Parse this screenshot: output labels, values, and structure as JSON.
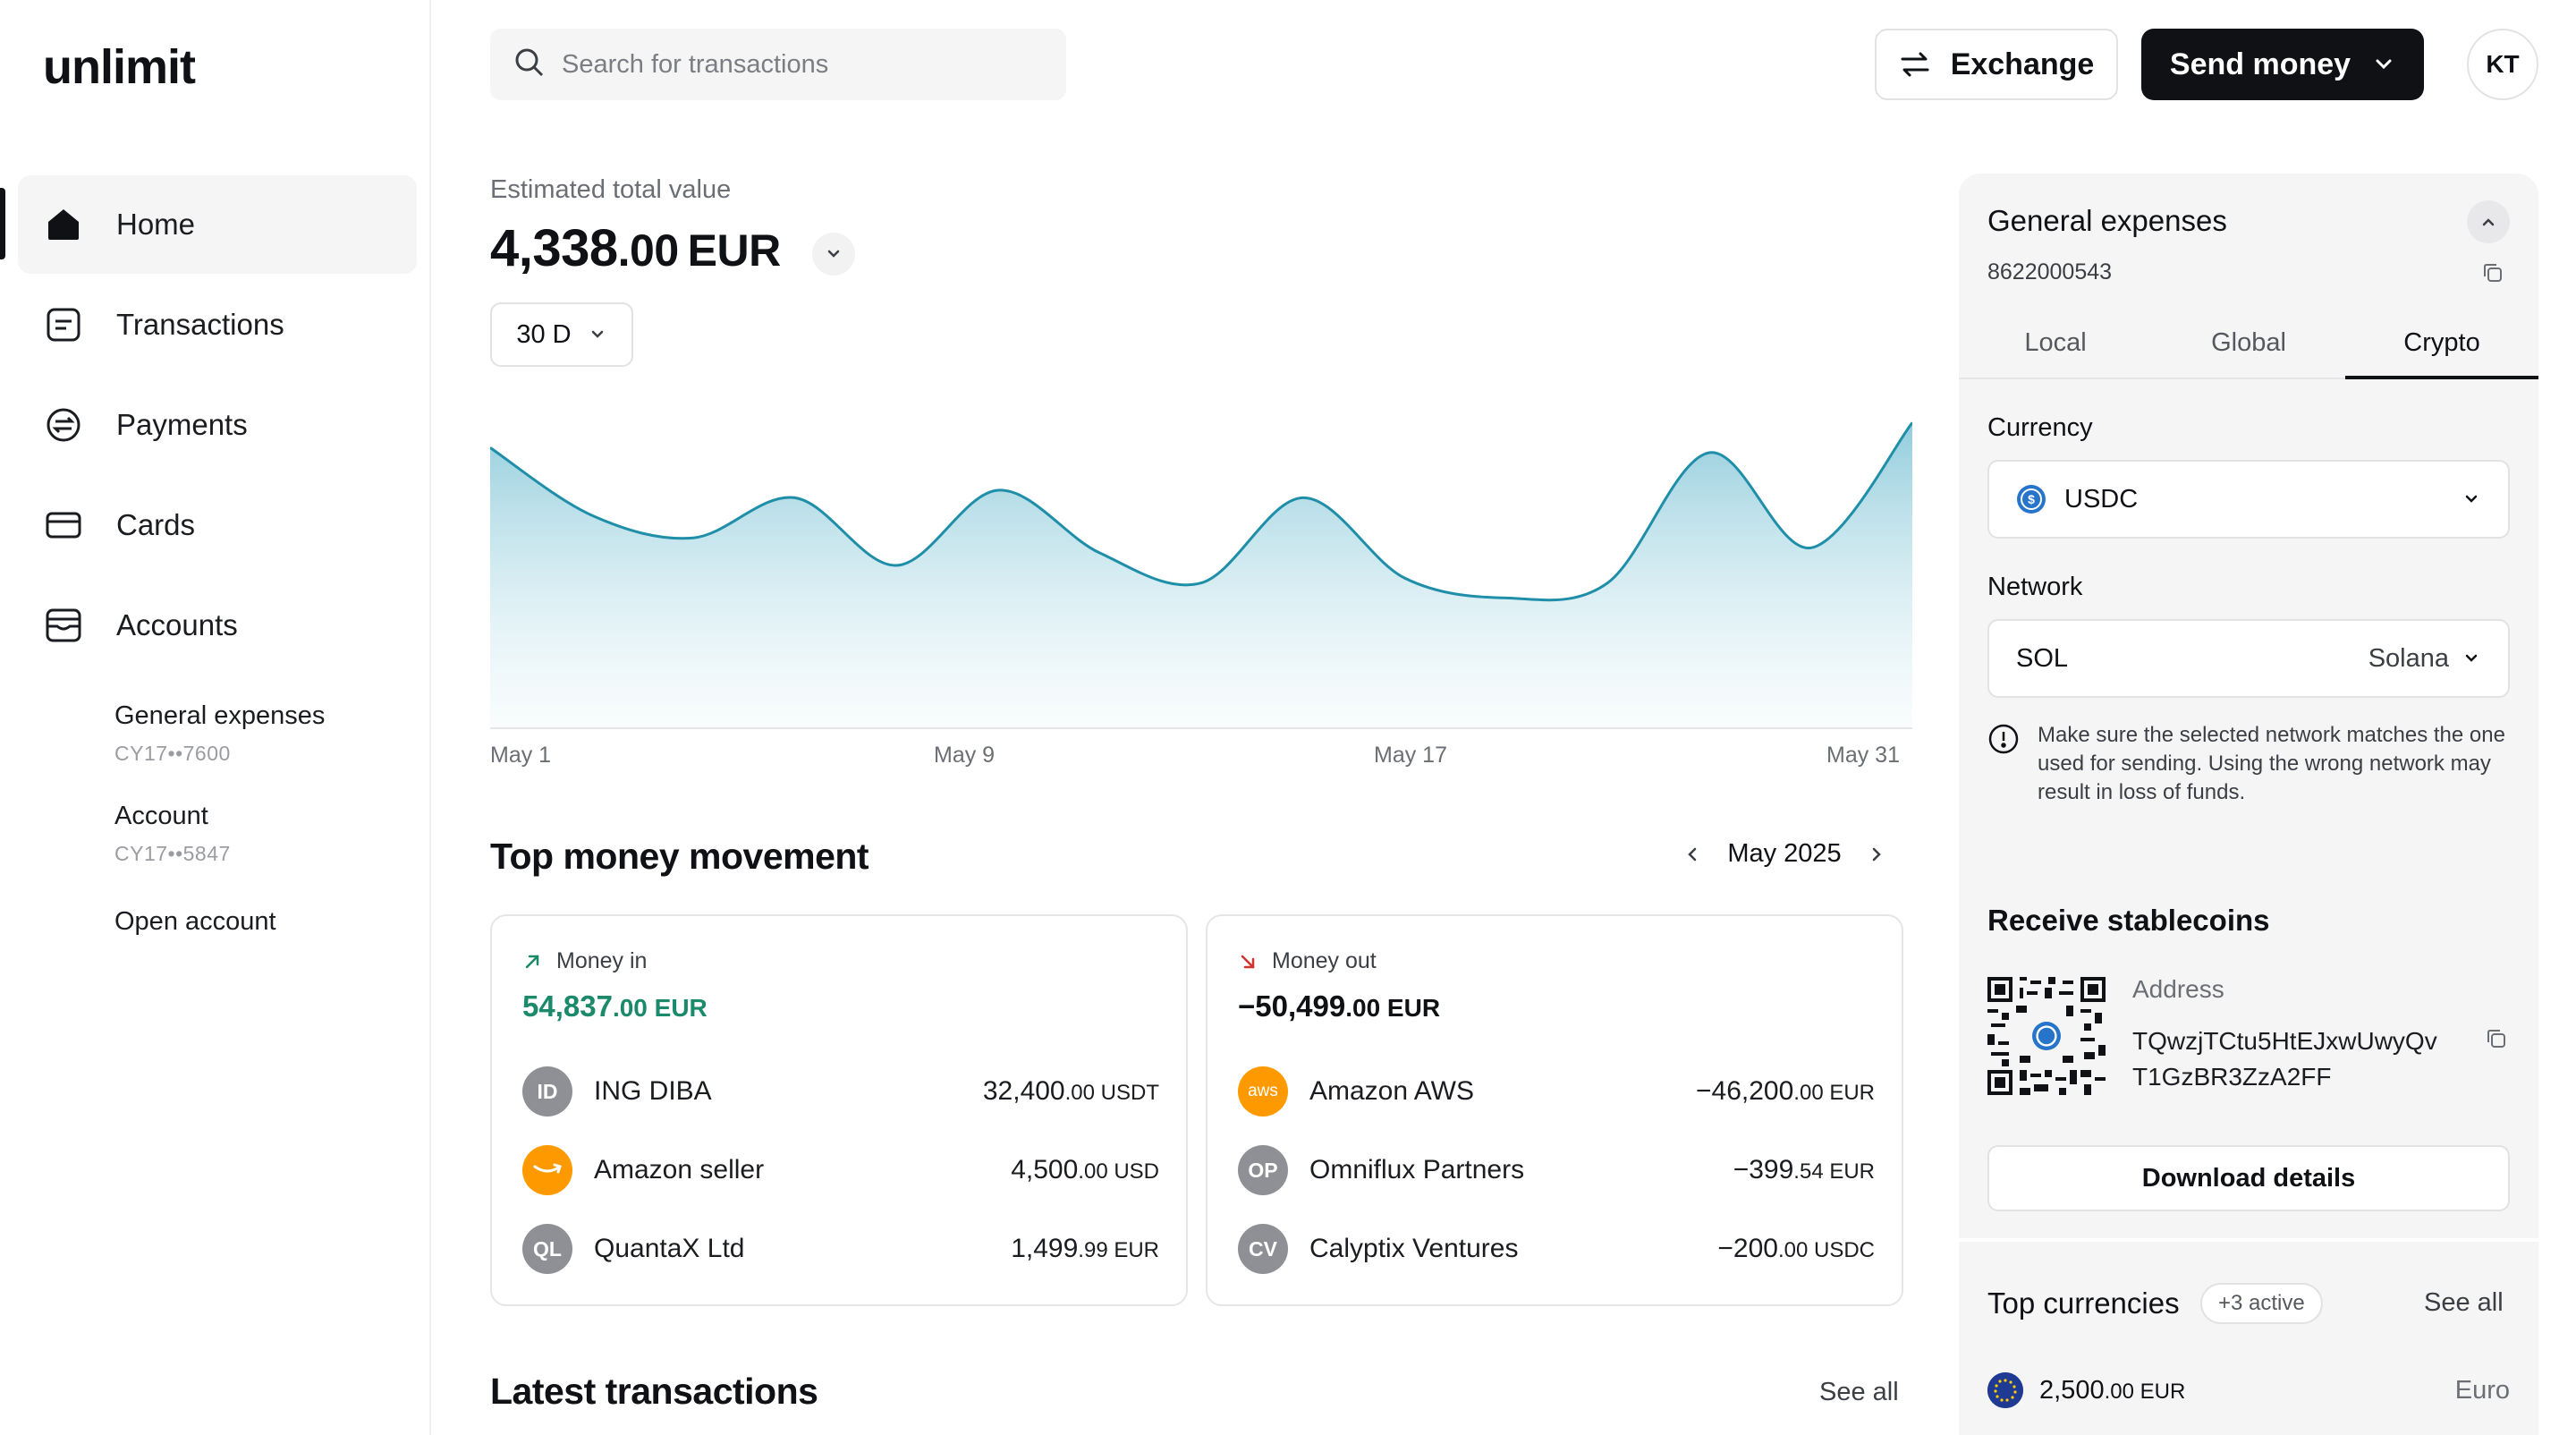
{
  "app": {
    "logo": "unlimit"
  },
  "sidebar": {
    "items": [
      {
        "label": "Home",
        "icon": "home-icon"
      },
      {
        "label": "Transactions",
        "icon": "list-icon"
      },
      {
        "label": "Payments",
        "icon": "transfer-icon"
      },
      {
        "label": "Cards",
        "icon": "card-icon"
      },
      {
        "label": "Accounts",
        "icon": "accounts-icon"
      }
    ],
    "accounts": [
      {
        "name": "General expenses",
        "number": "CY17••7600"
      },
      {
        "name": "Account",
        "number": "CY17••5847"
      }
    ],
    "open_account": "Open account"
  },
  "header": {
    "search_placeholder": "Search for transactions",
    "exchange_label": "Exchange",
    "send_label": "Send money",
    "avatar_initials": "KT"
  },
  "summary": {
    "label": "Estimated total value",
    "amount_int": "4,338",
    "amount_dec": ".00",
    "currency": "EUR",
    "period": "30 D"
  },
  "chart_data": {
    "type": "area",
    "x_ticks": [
      "May 1",
      "May 9",
      "May 17",
      "May 31"
    ],
    "values": [
      0.82,
      0.55,
      0.46,
      0.62,
      0.35,
      0.65,
      0.4,
      0.28,
      0.62,
      0.3,
      0.22,
      0.28,
      0.8,
      0.42,
      0.92
    ],
    "grid": true,
    "color": "#1f8ea8"
  },
  "movement": {
    "title": "Top money movement",
    "month": "May 2025",
    "money_in": {
      "label": "Money in",
      "total_int": "54,837",
      "total_dec": ".00 EUR",
      "rows": [
        {
          "initials": "ID",
          "name": "ING DIBA",
          "int": "32,400",
          "dec": ".00 USDT",
          "color": "#8e9095"
        },
        {
          "initials": "",
          "name": "Amazon seller",
          "int": "4,500",
          "dec": ".00 USD",
          "color": "#ff9900"
        },
        {
          "initials": "QL",
          "name": "QuantaX Ltd",
          "int": "1,499",
          "dec": ".99 EUR",
          "color": "#8e9095"
        }
      ]
    },
    "money_out": {
      "label": "Money out",
      "total_int": "−50,499",
      "total_dec": ".00 EUR",
      "rows": [
        {
          "initials": "aws",
          "name": "Amazon AWS",
          "int": "−46,200",
          "dec": ".00 EUR",
          "color": "#ff9900"
        },
        {
          "initials": "OP",
          "name": "Omniflux Partners",
          "int": "−399",
          "dec": ".54 EUR",
          "color": "#8e9095"
        },
        {
          "initials": "CV",
          "name": "Calyptix Ventures",
          "int": "−200",
          "dec": ".00 USDC",
          "color": "#8e9095"
        }
      ]
    }
  },
  "latest": {
    "title": "Latest transactions",
    "see_all": "See all"
  },
  "panel": {
    "title": "General expenses",
    "account_number": "8622000543",
    "tabs": [
      "Local",
      "Global",
      "Crypto"
    ],
    "currency_label": "Currency",
    "currency_value": "USDC",
    "network_label": "Network",
    "network_code": "SOL",
    "network_name": "Solana",
    "notice": "Make sure the selected network matches the one used for sending. Using the wrong network may result in loss of funds.",
    "receive_title": "Receive stablecoins",
    "address_label": "Address",
    "address_line1": "TQwzjTCtu5HtEJxwUwyQv",
    "address_line2": "T1GzBR3ZzA2FF",
    "download_label": "Download details",
    "top_currencies_title": "Top currencies",
    "active_badge": "+3 active",
    "see_all": "See all",
    "currency_row": {
      "int": "2,500",
      "dec": ".00 EUR",
      "name": "Euro"
    }
  }
}
